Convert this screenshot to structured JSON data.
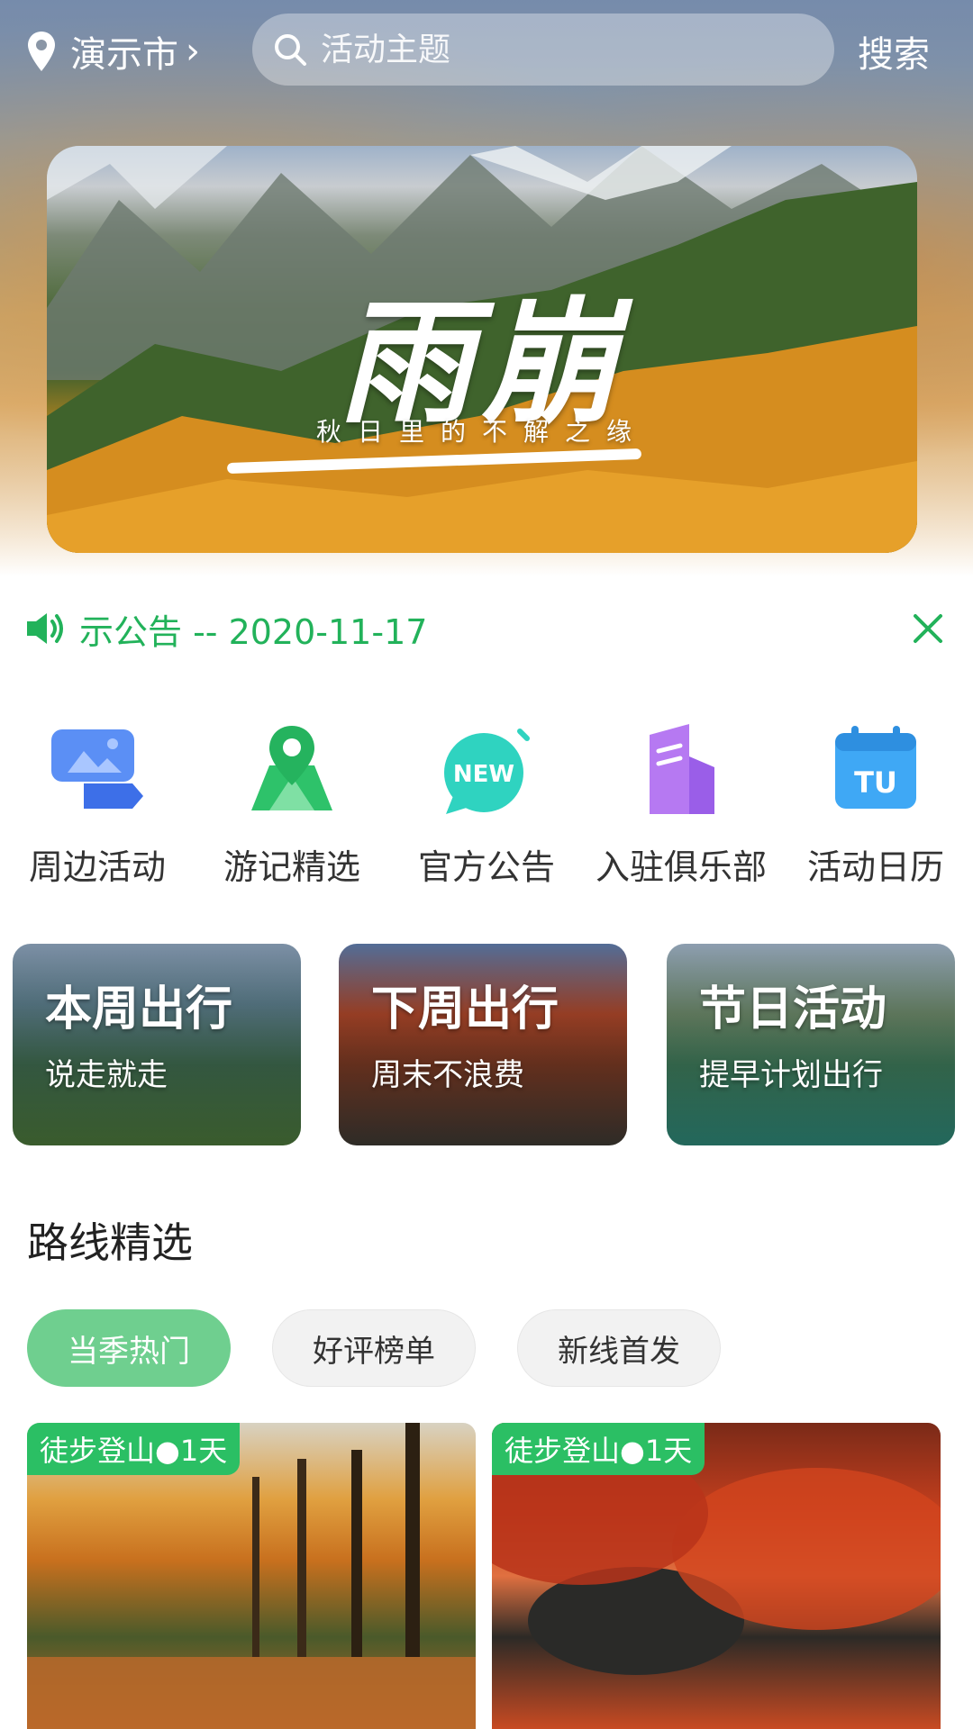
{
  "header": {
    "city": "演示市",
    "search_placeholder": "活动主题",
    "search_button": "搜索"
  },
  "banner": {
    "title": "雨崩",
    "subtitle": "秋日里的不解之缘"
  },
  "notice": {
    "text": "示公告 -- 2020-11-17"
  },
  "menu": [
    {
      "label": "周边活动",
      "icon": "photo-card-icon"
    },
    {
      "label": "游记精选",
      "icon": "map-pin-icon"
    },
    {
      "label": "官方公告",
      "icon": "new-badge-icon"
    },
    {
      "label": "入驻俱乐部",
      "icon": "building-icon"
    },
    {
      "label": "活动日历",
      "icon": "calendar-icon"
    }
  ],
  "trips": [
    {
      "title": "本周出行",
      "subtitle": "说走就走"
    },
    {
      "title": "下周出行",
      "subtitle": "周末不浪费"
    },
    {
      "title": "节日活动",
      "subtitle": "提早计划出行"
    }
  ],
  "routes_section": {
    "title": "路线精选",
    "tabs": [
      "当季热门",
      "好评榜单",
      "新线首发"
    ],
    "active_tab": "当季热门"
  },
  "routes": [
    {
      "tag": "徒步登山●1天"
    },
    {
      "tag": "徒步登山●1天"
    }
  ],
  "colors": {
    "accent": "#22b25a",
    "chip_active": "#6fcf8f",
    "tag_bg": "#2bbf64"
  }
}
